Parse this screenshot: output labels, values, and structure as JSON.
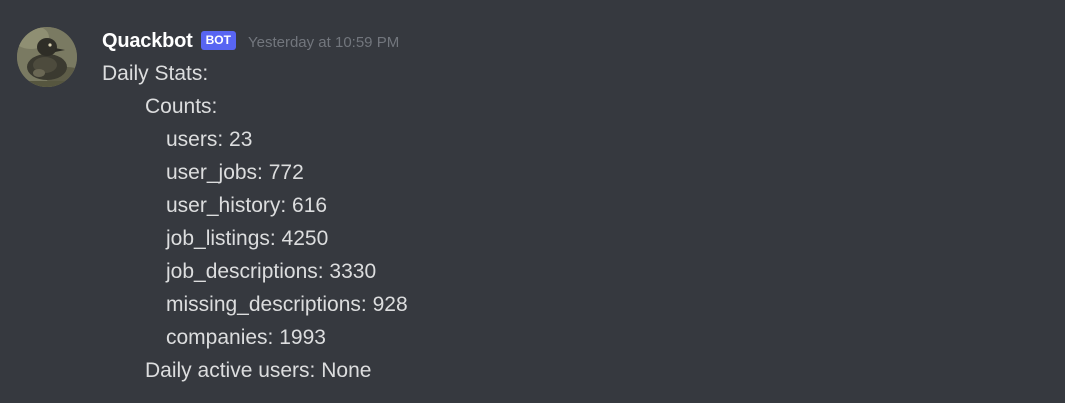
{
  "message": {
    "author": "Quackbot",
    "tag": "BOT",
    "timestamp": "Yesterday at 10:59 PM",
    "avatar_icon": "duck-avatar-icon",
    "lines": [
      "Daily Stats:",
      "Counts:",
      "users: 23",
      "user_jobs: 772",
      "user_history: 616",
      "job_listings: 4250",
      "job_descriptions: 3330",
      "missing_descriptions: 928",
      "companies: 1993",
      "Daily active users: None"
    ]
  },
  "colors": {
    "background": "#36393f",
    "text": "#dcddde",
    "username": "#ffffff",
    "bot_tag": "#5865f2",
    "timestamp": "#72767d"
  }
}
